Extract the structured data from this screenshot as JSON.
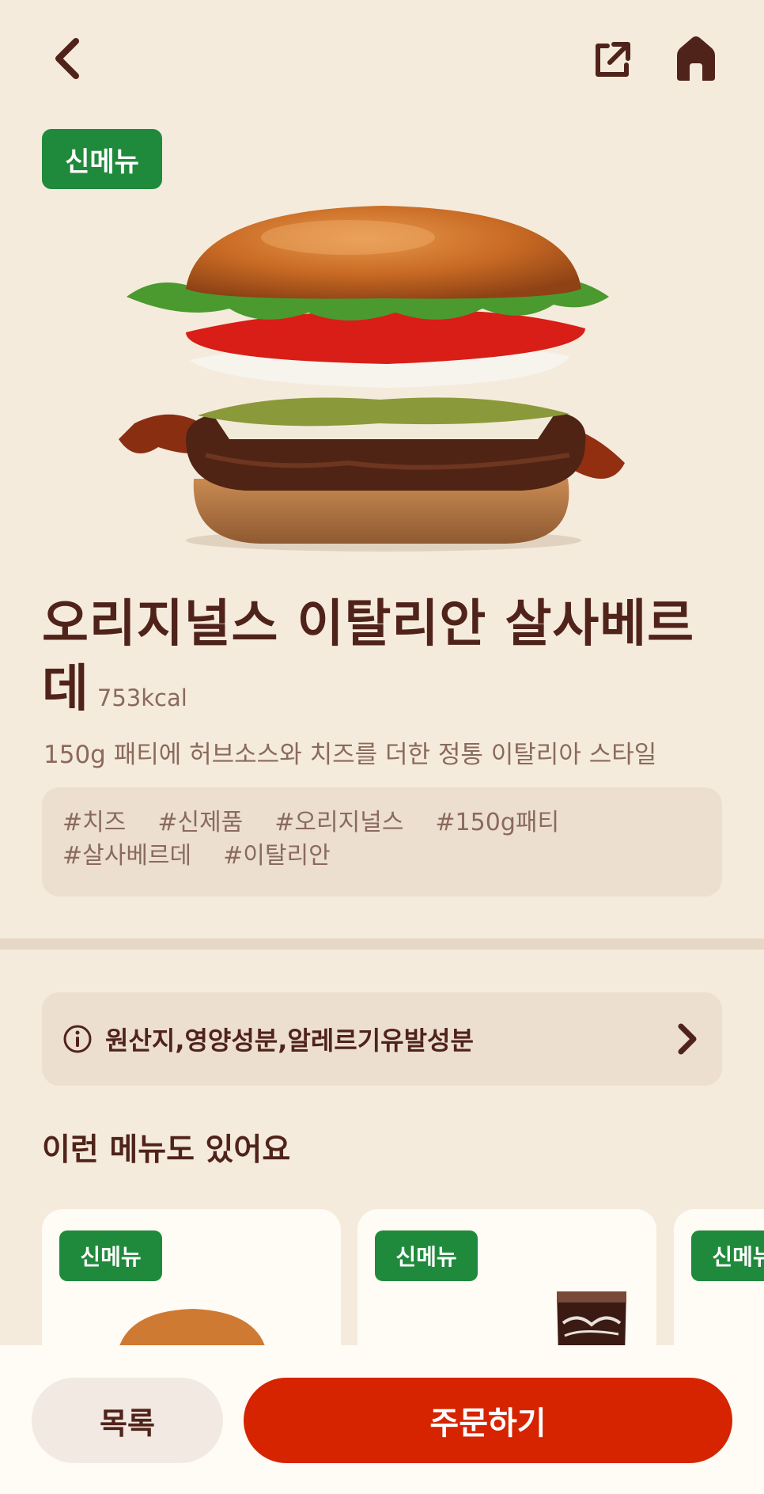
{
  "colors": {
    "background": "#f5ebdc",
    "brown": "#50231a",
    "muted": "#8a6a5c",
    "badge_green": "#1f8a3c",
    "order_red": "#d62300"
  },
  "header": {
    "back_icon": "chevron-left-icon",
    "share_icon": "share-icon",
    "home_icon": "home-icon"
  },
  "product": {
    "badge": "신메뉴",
    "name": "오리지널스 이탈리안 살사베르데",
    "kcal": "753kcal",
    "description": "150g 패티에 허브소스와 치즈를 더한 정통 이탈리아 스타일",
    "tags": [
      "#치즈",
      "#신제품",
      "#오리지널스",
      "#150g패티",
      "#살사베르데",
      "#이탈리안"
    ]
  },
  "info": {
    "label": "원산지,영양성분,알레르기유발성분"
  },
  "related": {
    "title": "이런 메뉴도 있어요",
    "items": [
      {
        "badge": "신메뉴"
      },
      {
        "badge": "신메뉴"
      },
      {
        "badge": "신메뉴"
      }
    ]
  },
  "footer": {
    "list_label": "목록",
    "order_label": "주문하기"
  }
}
